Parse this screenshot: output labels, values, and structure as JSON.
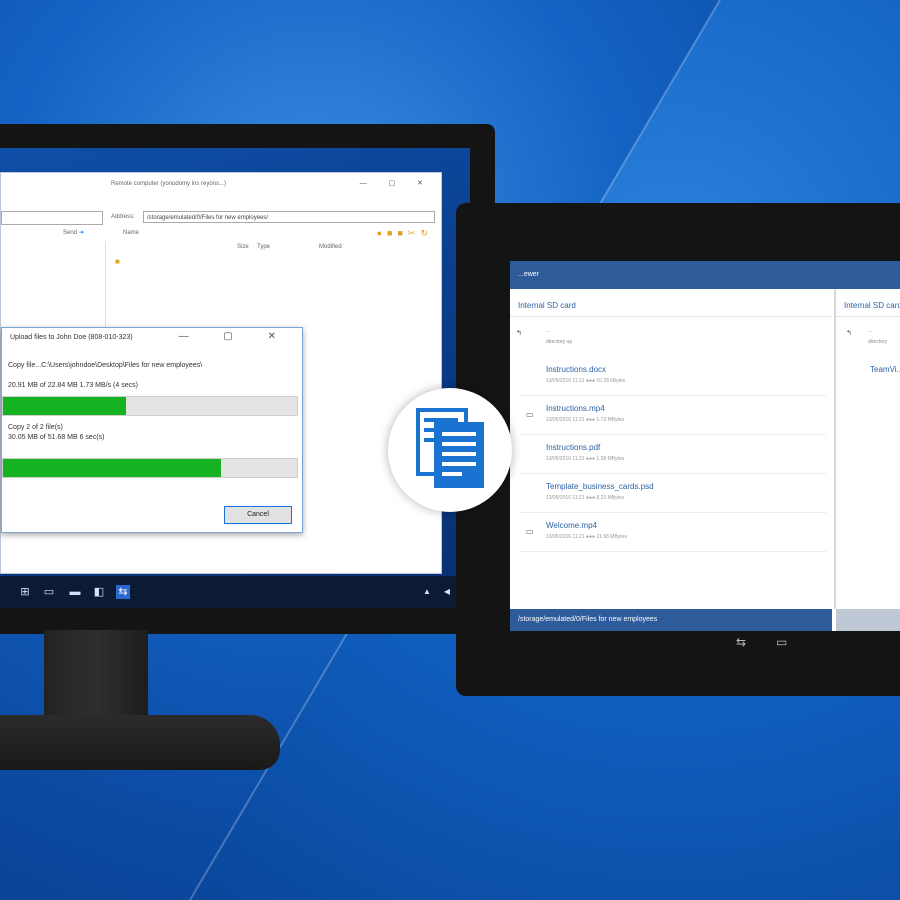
{
  "desktop_window": {
    "remote_label": "Remote computer (yonudomy ins reyons...)",
    "address_label": "Address:",
    "address_value": "/storage/emulated/0/Files for new employees/",
    "send_label": "Send",
    "column_headers": [
      "Name",
      "Size",
      "Type",
      "Modified"
    ],
    "controls": "— ▢ ✕"
  },
  "upload_dialog": {
    "title": "Upload files to John Doe (808-010-323)",
    "copy_line": "Copy file...C:\\Users\\johndoe\\Desktop\\Files for new employees\\",
    "progress1_text": "20.91 MB of 22.84 MB    1.73 MB/s (4 secs)",
    "progress1": 0.42,
    "files_text": "Copy 2 of 2 file(s)",
    "files_detail": "30.05 MB of 51.68 MB    6 sec(s)",
    "progress2": 0.74,
    "cancel_label": "Cancel",
    "controls": "— ▢ ✕"
  },
  "tablet": {
    "app_title": "...ewer",
    "left_pane_title": "Internal SD card",
    "right_pane_title": "Internal SD card",
    "up_label": "..",
    "up_sublabel": "directory up",
    "right_up_label": "..",
    "right_up_sublabel": "directory",
    "files": [
      {
        "name": "Instructions.docx",
        "meta": "13/05/2016 11:21    ●●●    10.28 kBytes",
        "icon": "doc-icon"
      },
      {
        "name": "Instructions.mp4",
        "meta": "13/05/2016 11:21    ●●●    1.73 MBytes",
        "icon": "video-icon"
      },
      {
        "name": "Instructions.pdf",
        "meta": "13/05/2016 11:21    ●●●    1.28 MBytes",
        "icon": "pdf-icon"
      },
      {
        "name": "Template_business_cards.psd",
        "meta": "13/05/2016 11:21    ●●●    8.23 MBytes",
        "icon": "image-icon"
      },
      {
        "name": "Welcome.mp4",
        "meta": "13/05/2016 11:21    ●●●    21.68 MBytes",
        "icon": "video-icon"
      }
    ],
    "right_item": "TeamVi...",
    "path_bar": "/storage/emulated/0/Files for new employees"
  },
  "taskbar": {
    "icons": [
      "windows-icon",
      "task-view-icon",
      "folder-icon",
      "store-icon",
      "teamviewer-icon"
    ]
  },
  "colors": {
    "accent": "#2e5b9a",
    "progress": "#15b221",
    "background": "#1463c4"
  }
}
